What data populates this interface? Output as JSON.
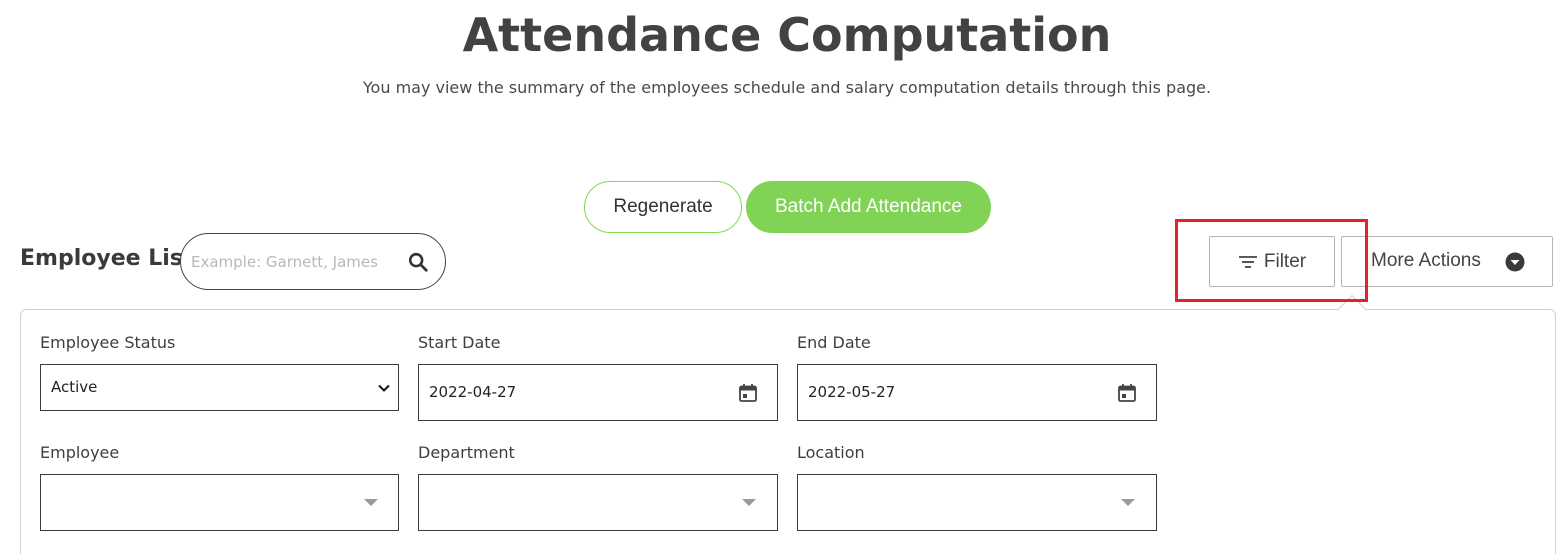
{
  "header": {
    "title": "Attendance Computation",
    "subtitle": "You may view the summary of the employees schedule and salary computation details through this page."
  },
  "actions": {
    "regenerate_label": "Regenerate",
    "batch_add_label": "Batch Add Attendance",
    "filter_label": "Filter",
    "more_actions_label": "More Actions"
  },
  "employee_list": {
    "label": "Employee List",
    "search_placeholder": "Example: Garnett, James",
    "search_value": ""
  },
  "filters": {
    "employee_status": {
      "label": "Employee Status",
      "value": "Active"
    },
    "start_date": {
      "label": "Start Date",
      "value": "2022-04-27"
    },
    "end_date": {
      "label": "End Date",
      "value": "2022-05-27"
    },
    "employee": {
      "label": "Employee",
      "value": ""
    },
    "department": {
      "label": "Department",
      "value": ""
    },
    "location": {
      "label": "Location",
      "value": ""
    }
  },
  "icons": {
    "search": "search-icon",
    "filter": "filter-icon",
    "more_actions_caret": "caret-down-circle-icon",
    "select_chevron": "chevron-down-icon",
    "calendar": "calendar-icon",
    "dropdown_triangle": "triangle-down-icon"
  },
  "colors": {
    "accent_green": "#80d354",
    "highlight_red": "#e3222b",
    "title_text": "#424242"
  }
}
